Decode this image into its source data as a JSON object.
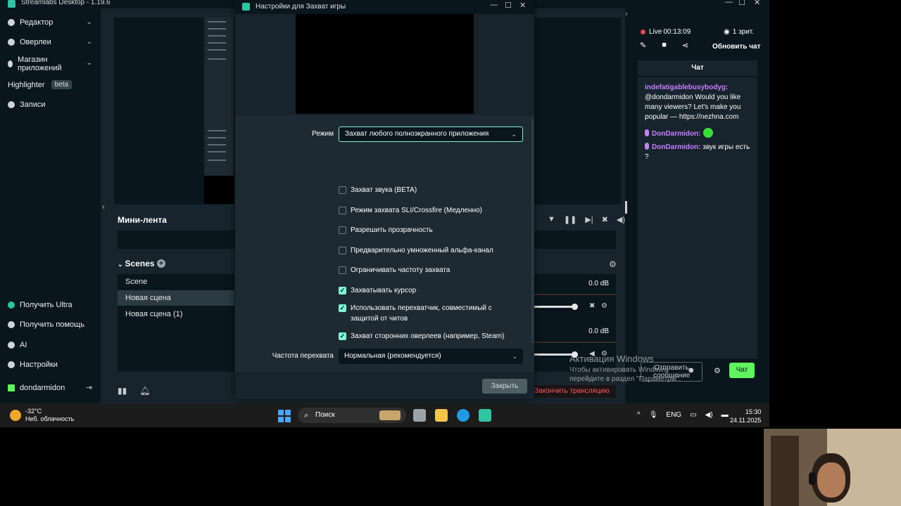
{
  "app": {
    "title": "Streamlabs Desktop - 1.19.6"
  },
  "sidebar": {
    "items": [
      {
        "label": "Редактор"
      },
      {
        "label": "Оверлеи"
      },
      {
        "label": "Магазин приложений"
      },
      {
        "label": "Highlighter",
        "badge": "beta"
      },
      {
        "label": "Записи"
      }
    ],
    "bottom": [
      {
        "label": "Получить Ultra"
      },
      {
        "label": "Получить помощь"
      },
      {
        "label": "AI"
      },
      {
        "label": "Настройки"
      }
    ],
    "user": "dondarmidon"
  },
  "editor": {
    "minifeed_title": "Мини-лента",
    "scenes_title": "Scenes",
    "scenes": [
      {
        "name": "Scene",
        "active": false
      },
      {
        "name": "Новая сцена",
        "active": true
      },
      {
        "name": "Новая сцена (1)",
        "active": false
      }
    ],
    "mixer": [
      {
        "db": "0.0 dB"
      },
      {
        "db": "0.0 dB"
      }
    ],
    "end_stream_label": "Закончить трансляцию"
  },
  "chat_panel": {
    "live_label": "Live",
    "live_time": "00:13:09",
    "viewers": "1 зрит.",
    "refresh_label": "Обновить чат",
    "header": "Чат",
    "messages": [
      {
        "user": "indefatigablebusybodyg:",
        "text": "@dondarmidon Would you like many viewers? Let's make you popular — https://nezhna.com"
      },
      {
        "user": "DonDarmidon:",
        "text": ""
      },
      {
        "user": "DonDarmidon:",
        "text": "звук игры есть ?"
      }
    ],
    "input_label": "Отправить сообщение",
    "send_label": "Чат"
  },
  "watermark": {
    "title": "Активация Windows",
    "subtitle": "Чтобы активировать Windows, перейдите в раздел \"Параметры\"."
  },
  "dialog": {
    "title": "Настройки для Захват игры",
    "mode_label": "Режим",
    "mode_value": "Захват любого полноэкранного приложения",
    "checkboxes": [
      {
        "label": "Захват звука (BETA)",
        "checked": false
      },
      {
        "label": "Режим захвата SLI/Crossfire (Медленно)",
        "checked": false
      },
      {
        "label": "Разрешить прозрачность",
        "checked": false
      },
      {
        "label": "Предварительно умноженный альфа-канал",
        "checked": false
      },
      {
        "label": "Ограничивать частоту захвата",
        "checked": false
      },
      {
        "label": "Захватывать курсор",
        "checked": true
      },
      {
        "label": "Использовать перехватчик, совместимый с защитой от читов",
        "checked": true
      },
      {
        "label": "Захват сторонних оверлеев (например, Steam)",
        "checked": true
      }
    ],
    "rate_label": "Частота перехвата",
    "rate_value": "Нормальная (рекомендуется)",
    "close_label": "Закрыть"
  },
  "taskbar": {
    "temperature": "-32°C",
    "weather": "Неб. облачность",
    "search_placeholder": "Поиск",
    "language": "ENG",
    "time": "15:30",
    "date": "24.11.2025"
  },
  "colors": {
    "accent": "#80f5d2",
    "live": "#e5484d",
    "chat_user": "#c77dff",
    "danger": "#ff5a5a"
  }
}
